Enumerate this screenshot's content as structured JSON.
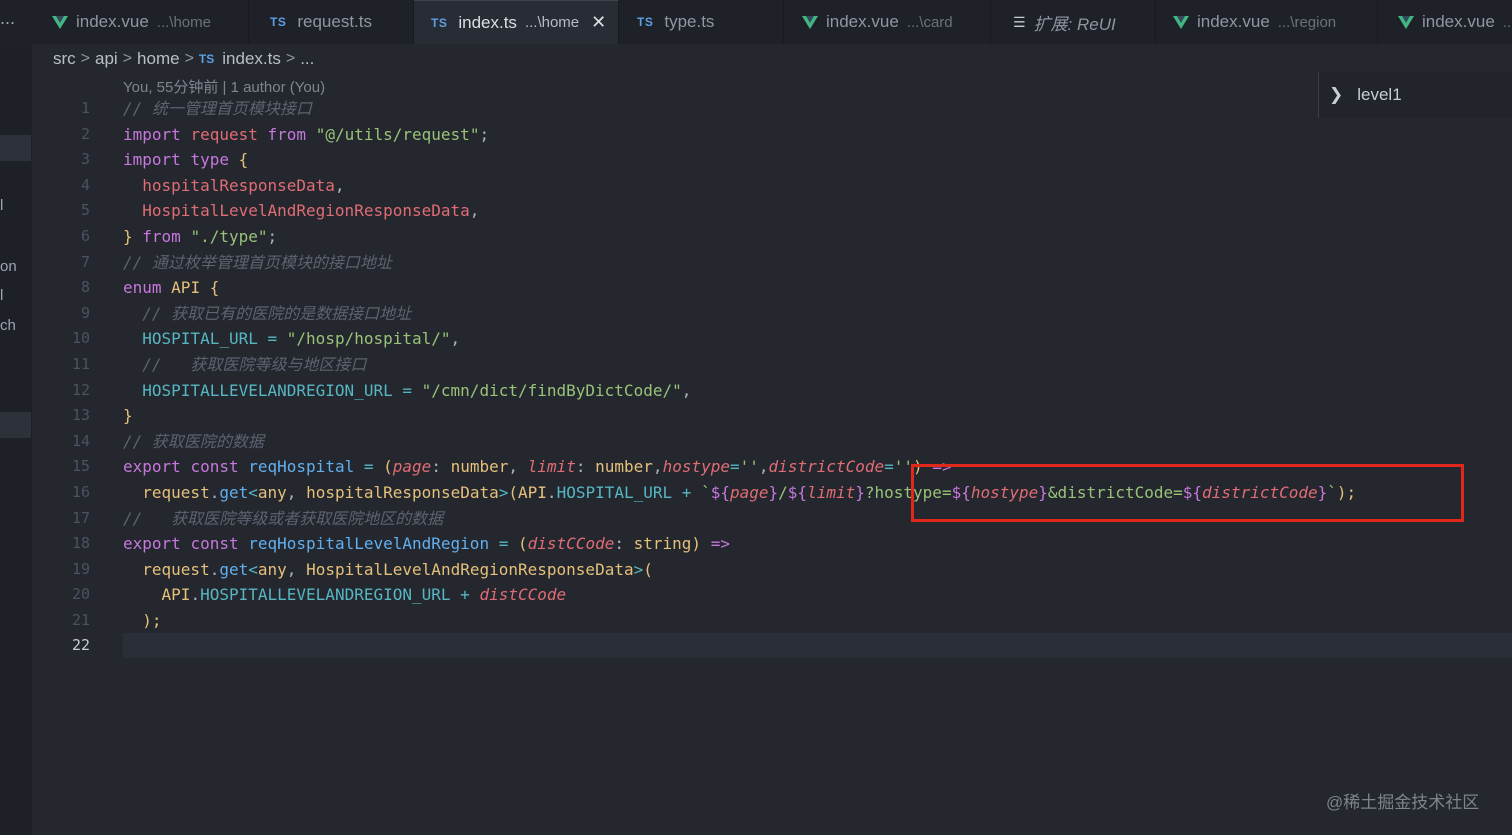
{
  "tabs": [
    {
      "icon": "vue-icon",
      "label": "index.vue",
      "hint": "...\\home",
      "active": false
    },
    {
      "icon": "ts-icon",
      "label": "request.ts",
      "hint": "",
      "active": false
    },
    {
      "icon": "ts-icon",
      "label": "index.ts",
      "hint": "...\\home",
      "active": true
    },
    {
      "icon": "ts-icon",
      "label": "type.ts",
      "hint": "",
      "active": false
    },
    {
      "icon": "vue-icon",
      "label": "index.vue",
      "hint": "...\\card",
      "active": false
    },
    {
      "icon": "list-icon",
      "label": "扩展: ReUI",
      "hint": "",
      "active": false
    },
    {
      "icon": "vue-icon",
      "label": "index.vue",
      "hint": "...\\region",
      "active": false
    },
    {
      "icon": "vue-icon",
      "label": "index.vue",
      "hint": "...",
      "active": false
    }
  ],
  "icons": {
    "ts": "TS",
    "more": "..."
  },
  "breadcrumb": {
    "items": [
      "src",
      "api",
      "home",
      "index.ts",
      "..."
    ],
    "separator": ">"
  },
  "side_fragments": [
    "l",
    "on",
    "l",
    "ch"
  ],
  "blame": "You, 55分钟前 | 1 author (You)",
  "outline": {
    "label": "level1"
  },
  "line_numbers": [
    "1",
    "2",
    "3",
    "4",
    "5",
    "6",
    "7",
    "8",
    "9",
    "10",
    "11",
    "12",
    "13",
    "14",
    "15",
    "16",
    "17",
    "18",
    "19",
    "20",
    "21",
    "22"
  ],
  "code": {
    "l1_comment": "// 统一管理首页模块接口",
    "l2": {
      "import": "import",
      "request": "request",
      "from": "from",
      "path": "\"@/utils/request\"",
      "semi": ";"
    },
    "l3": {
      "import": "import",
      "type": "type",
      "brace": "{"
    },
    "l4": {
      "name": "hospitalResponseData",
      "comma": ","
    },
    "l5": {
      "name": "HospitalLevelAndRegionResponseData",
      "comma": ","
    },
    "l6": {
      "brace": "}",
      "from": "from",
      "path": "\"./type\"",
      "semi": ";"
    },
    "l7_comment": "// 通过枚举管理首页模块的接口地址",
    "l8": {
      "enum": "enum",
      "name": "API",
      "brace": "{"
    },
    "l9_comment": "// 获取已有的医院的是数据接口地址",
    "l10": {
      "name": "HOSPITAL_URL",
      "eq": "=",
      "value": "\"/hosp/hospital/\"",
      "comma": ","
    },
    "l11_comment": "//   获取医院等级与地区接口",
    "l12": {
      "name": "HOSPITALLEVELANDREGION_URL",
      "eq": "=",
      "value": "\"/cmn/dict/findByDictCode/\"",
      "comma": ","
    },
    "l13": {
      "brace": "}"
    },
    "l14_comment": "// 获取医院的数据",
    "l15": {
      "export": "export",
      "const": "const",
      "name": "reqHospital",
      "eq": "=",
      "open": "(",
      "p1": "page",
      "colon1": ":",
      "t1": "number",
      "sep1": ",",
      "p2": "limit",
      "colon2": ":",
      "t2": "number",
      "sep2": ",",
      "p3": "hostype",
      "eq3": "=",
      "d3": "''",
      "sep3": ",",
      "p4": "districtCode",
      "eq4": "=",
      "d4": "''",
      "close": ")",
      "arrow": "=>"
    },
    "l16": {
      "request": "request",
      "dot": ".",
      "get": "get",
      "lt": "<",
      "any": "any",
      "comma": ",",
      "type": "hospitalResponseData",
      "gt": ">",
      "open": "(",
      "api": "API",
      "dot2": ".",
      "url": "HOSPITAL_URL",
      "plus": "+",
      "tick": "`",
      "i1o": "${",
      "v1": "page",
      "i1c": "}",
      "slash": "/",
      "i2o": "${",
      "v2": "limit",
      "i2c": "}",
      "q1": "?hostype=",
      "i3o": "${",
      "v3": "hostype",
      "i3c": "}",
      "q2": "&districtCode=",
      "i4o": "${",
      "v4": "districtCode",
      "i4c": "}",
      "tick2": "`",
      "end": ");"
    },
    "l17_comment": "//   获取医院等级或者获取医院地区的数据",
    "l18": {
      "export": "export",
      "const": "const",
      "name": "reqHospitalLevelAndRegion",
      "eq": "=",
      "open": "(",
      "p": "distCCode",
      "colon": ":",
      "t": "string",
      "close": ")",
      "arrow": "=>"
    },
    "l19": {
      "request": "request",
      "dot": ".",
      "get": "get",
      "lt": "<",
      "any": "any",
      "comma": ",",
      "type": "HospitalLevelAndRegionResponseData",
      "gt": ">",
      "open": "("
    },
    "l20": {
      "api": "API",
      "dot": ".",
      "url": "HOSPITALLEVELANDREGION_URL",
      "plus": "+",
      "p": "distCCode"
    },
    "l21": {
      "end": ");"
    }
  },
  "watermark": "@稀土掘金技术社区",
  "colors": {
    "highlight_box": "#e1261c",
    "background": "#24272e",
    "keyword": "#c678dd",
    "string": "#98c379"
  }
}
